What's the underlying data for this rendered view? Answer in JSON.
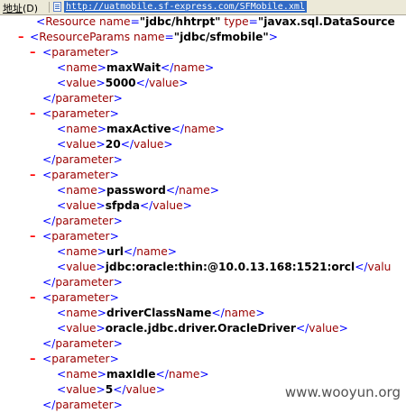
{
  "address_bar": {
    "label_underlined": "地址",
    "label_rest": "(D)",
    "url": "http://uatmobile.sf-express.com/SFMobile.xml"
  },
  "xml": {
    "resource_line": {
      "tag": "Resource",
      "attr1_name": "name",
      "attr1_value": "\"jdbc/hhtrpt\"",
      "attr2_name": "type",
      "attr2_value": "\"javax.sql.DataSource"
    },
    "params_tag": "ResourceParams",
    "params_attr_name": "name",
    "params_attr_value": "\"jdbc/sfmobile\"",
    "param_tag": "parameter",
    "name_tag": "name",
    "value_tag": "value",
    "toggle_symbol": "–",
    "parameters": [
      {
        "name": "maxWait",
        "value": "5000"
      },
      {
        "name": "maxActive",
        "value": "20"
      },
      {
        "name": "password",
        "value": "sfpda"
      },
      {
        "name": "url",
        "value": "jdbc:oracle:thin:@10.0.13.168:1521:orcl",
        "truncated_close": "</valu"
      },
      {
        "name": "driverClassName",
        "value": "oracle.jdbc.driver.OracleDriver"
      },
      {
        "name": "maxIdle",
        "value": "5"
      }
    ]
  },
  "watermark": "www.wooyun.org"
}
